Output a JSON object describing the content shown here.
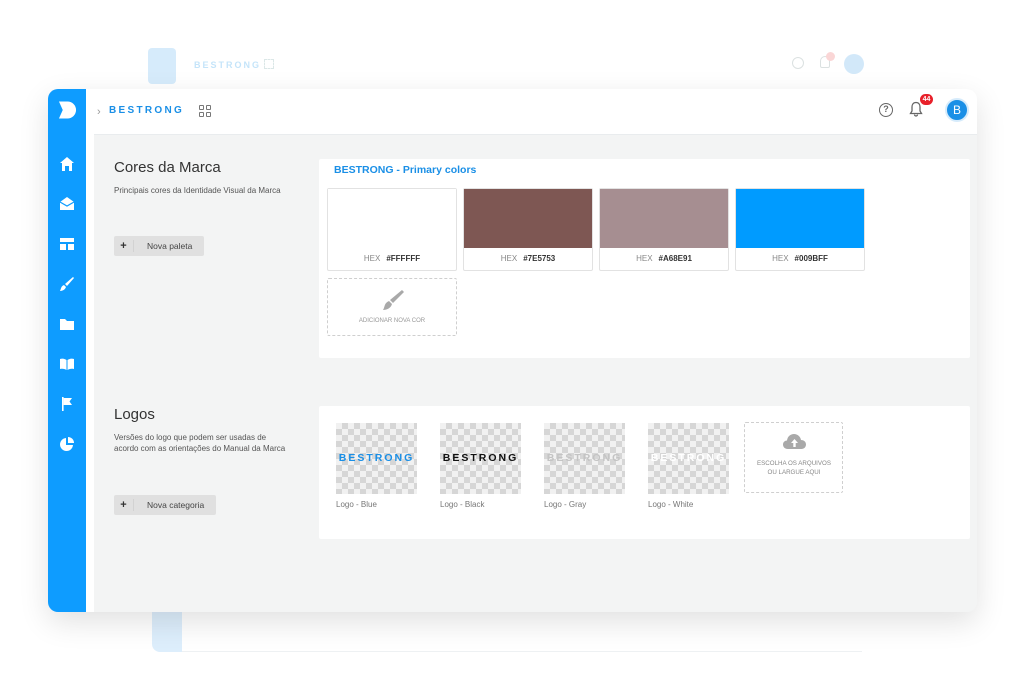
{
  "app": {
    "brand": "BESTRONG",
    "notification_count": "44",
    "user_initial": "B",
    "accent_color": "#0e9cff"
  },
  "sidebar": {
    "items": [
      {
        "name": "home",
        "icon": "home-icon"
      },
      {
        "name": "inbox",
        "icon": "inbox-icon"
      },
      {
        "name": "layout",
        "icon": "layout-icon"
      },
      {
        "name": "brush",
        "icon": "brush-icon"
      },
      {
        "name": "folder",
        "icon": "folder-icon"
      },
      {
        "name": "manual",
        "icon": "book-icon",
        "active": true
      },
      {
        "name": "flag",
        "icon": "flag-icon"
      },
      {
        "name": "reports",
        "icon": "pie-chart-icon"
      }
    ]
  },
  "colors_section": {
    "title": "Cores da Marca",
    "description": "Principais cores da Identidade Visual da Marca",
    "add_button": "Nova paleta",
    "palette_title": "BESTRONG - Primary colors",
    "hex_label": "HEX",
    "swatches": [
      {
        "hex": "#FFFFFF"
      },
      {
        "hex": "#7E5753"
      },
      {
        "hex": "#A68E91"
      },
      {
        "hex": "#009BFF"
      }
    ],
    "add_color_label": "ADICIONAR NOVA COR"
  },
  "logos_section": {
    "title": "Logos",
    "description": "Versões do logo que podem ser usadas de acordo com as orientações do Manual da Marca",
    "add_button": "Nova categoria",
    "logos": [
      {
        "caption": "Logo - Blue",
        "wordmark": "BESTRONG",
        "color": "#1a8fe6"
      },
      {
        "caption": "Logo - Black",
        "wordmark": "BESTRONG",
        "color": "#111111"
      },
      {
        "caption": "Logo - Gray",
        "wordmark": "BESTRONG",
        "color": "#c4c4c4"
      },
      {
        "caption": "Logo - White",
        "wordmark": "BESTRONG",
        "color": "#ffffff"
      }
    ],
    "upload_text": "ESCOLHA OS ARQUIVOS OU LARGUE AQUI"
  }
}
